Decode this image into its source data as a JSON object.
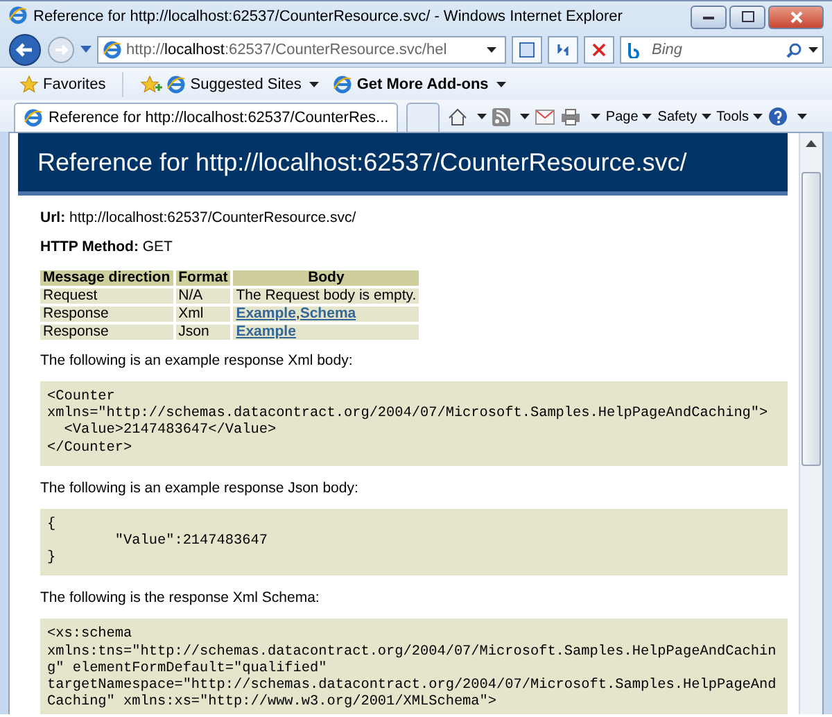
{
  "window": {
    "title": "Reference for http://localhost:62537/CounterResource.svc/ - Windows Internet Explorer"
  },
  "address_bar": {
    "url": "http://**localhost**:62537/CounterResource.svc/hel",
    "search_placeholder": "Bing"
  },
  "favorites_bar": [
    {
      "label": "Favorites",
      "kind": "favorites",
      "bold": false
    },
    {
      "label": "Suggested Sites",
      "kind": "suggested",
      "bold": false
    },
    {
      "label": "Get More Add-ons",
      "kind": "addons",
      "bold": true
    }
  ],
  "tabs": [
    {
      "label": "Reference for http://localhost:62537/CounterRes...",
      "selected": true
    }
  ],
  "command_bar": [
    "Page",
    "Safety",
    "Tools"
  ],
  "page": {
    "heading": "Reference for http://localhost:62537/CounterResource.svc/",
    "fields": [
      {
        "label": "Url:",
        "value": "http://localhost:62537/CounterResource.svc/"
      },
      {
        "label": "HTTP Method:",
        "value": "GET"
      }
    ],
    "table": {
      "columns": [
        "Message direction",
        "Format",
        "Body"
      ],
      "rows": [
        {
          "direction": "Request",
          "format": "N/A",
          "body": [
            {
              "text": "The Request body is empty.",
              "link": false
            }
          ]
        },
        {
          "direction": "Response",
          "format": "Xml",
          "body": [
            {
              "text": "Example",
              "link": true
            },
            {
              "text": ",",
              "link": false
            },
            {
              "text": "Schema",
              "link": true
            }
          ]
        },
        {
          "direction": "Response",
          "format": "Json",
          "body": [
            {
              "text": "Example",
              "link": true
            }
          ]
        }
      ]
    },
    "sections": [
      {
        "intro": "The following is an example response Xml body:",
        "code": [
          "<Counter",
          "xmlns=\"http://schemas.datacontract.org/2004/07/Microsoft.Samples.HelpPageAndCaching\">",
          "  <Value>2147483647</Value>",
          "</Counter>"
        ]
      },
      {
        "intro": "The following is an example response Json body:",
        "code": [
          "{",
          "        \"Value\":2147483647",
          "}"
        ]
      },
      {
        "intro": "The following is the response Xml Schema:",
        "code": [
          "<xs:schema",
          "xmlns:tns=\"http://schemas.datacontract.org/2004/07/Microsoft.Samples.HelpPageAndCachin",
          "g\" elementFormDefault=\"qualified\"",
          "targetNamespace=\"http://schemas.datacontract.org/2004/07/Microsoft.Samples.HelpPageAnd",
          "Caching\" xmlns:xs=\"http://www.w3.org/2001/XMLSchema\">"
        ]
      }
    ]
  }
}
